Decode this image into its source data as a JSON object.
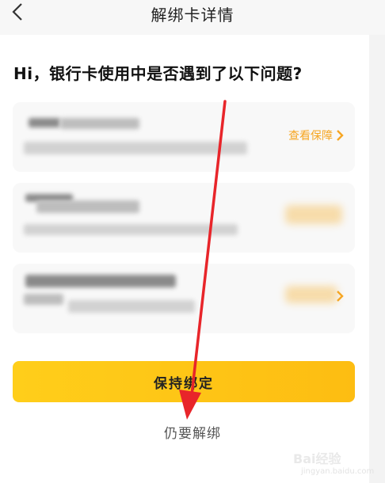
{
  "header": {
    "title": "解绑卡详情"
  },
  "question": "Hi，银行卡使用中是否遇到了以下问题?",
  "cards": [
    {
      "link_label": "查看保障"
    },
    {
      "link_label": ""
    },
    {
      "link_label": ""
    }
  ],
  "actions": {
    "keep_label": "保持绑定",
    "unbind_label": "仍要解绑"
  },
  "watermark": {
    "logo_text": "Bai经验",
    "sub_text": "jingyan.baidu.com"
  },
  "colors": {
    "accent": "#f6a623",
    "button": "#ffc81a",
    "arrow": "#e8252a"
  }
}
